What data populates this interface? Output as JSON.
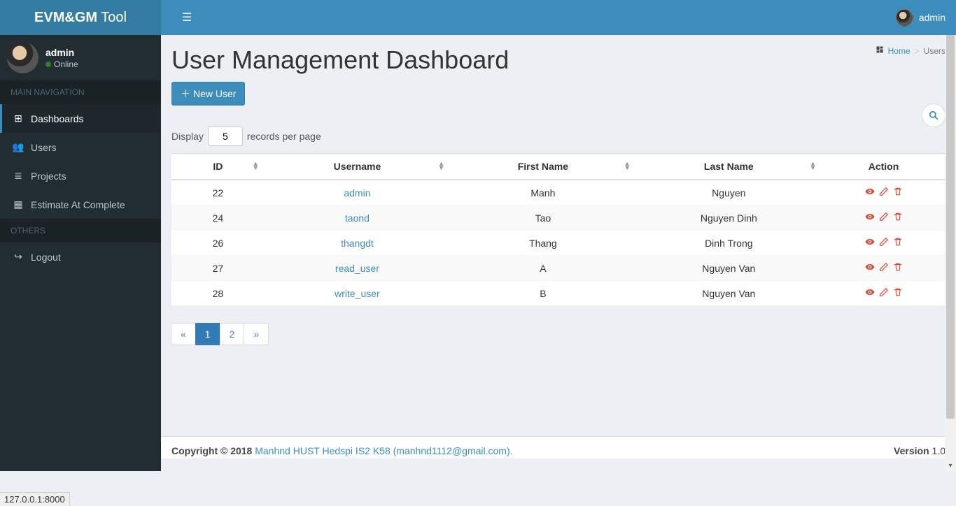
{
  "brand": {
    "bold": "EVM&GM",
    "light": " Tool"
  },
  "header": {
    "username": "admin"
  },
  "sidebar": {
    "user": {
      "name": "admin",
      "status": "Online"
    },
    "headings": {
      "main": "MAIN NAVIGATION",
      "others": "OTHERS"
    },
    "items": [
      {
        "label": "Dashboards",
        "icon": "⊞",
        "active": true
      },
      {
        "label": "Users",
        "icon": "👥",
        "active": false
      },
      {
        "label": "Projects",
        "icon": "≣",
        "active": false
      },
      {
        "label": "Estimate At Complete",
        "icon": "▦",
        "active": false
      }
    ],
    "others": [
      {
        "label": "Logout",
        "icon": "↪"
      }
    ]
  },
  "page": {
    "title": "User Management Dashboard",
    "breadcrumb": {
      "home": "Home",
      "current": "Users"
    },
    "new_user": "New User",
    "display_prefix": "Display",
    "display_value": "5",
    "display_suffix": "records per page"
  },
  "table": {
    "columns": [
      "ID",
      "Username",
      "First Name",
      "Last Name",
      "Action"
    ],
    "rows": [
      {
        "id": "22",
        "username": "admin",
        "first": "Manh",
        "last": "Nguyen"
      },
      {
        "id": "24",
        "username": "taond",
        "first": "Tao",
        "last": "Nguyen Dinh"
      },
      {
        "id": "26",
        "username": "thangdt",
        "first": "Thang",
        "last": "Dinh Trong"
      },
      {
        "id": "27",
        "username": "read_user",
        "first": "A",
        "last": "Nguyen Van"
      },
      {
        "id": "28",
        "username": "write_user",
        "first": "B",
        "last": "Nguyen Van"
      }
    ]
  },
  "pagination": {
    "prev": "«",
    "pages": [
      "1",
      "2"
    ],
    "next": "»",
    "active": "1"
  },
  "footer": {
    "copyright": "Copyright © 2018",
    "link": "Manhnd HUST Hedspi IS2 K58 (manhnd1112@gmail.com).",
    "version_label": "Version",
    "version": " 1.0"
  },
  "status_tip": "127.0.0.1:8000"
}
